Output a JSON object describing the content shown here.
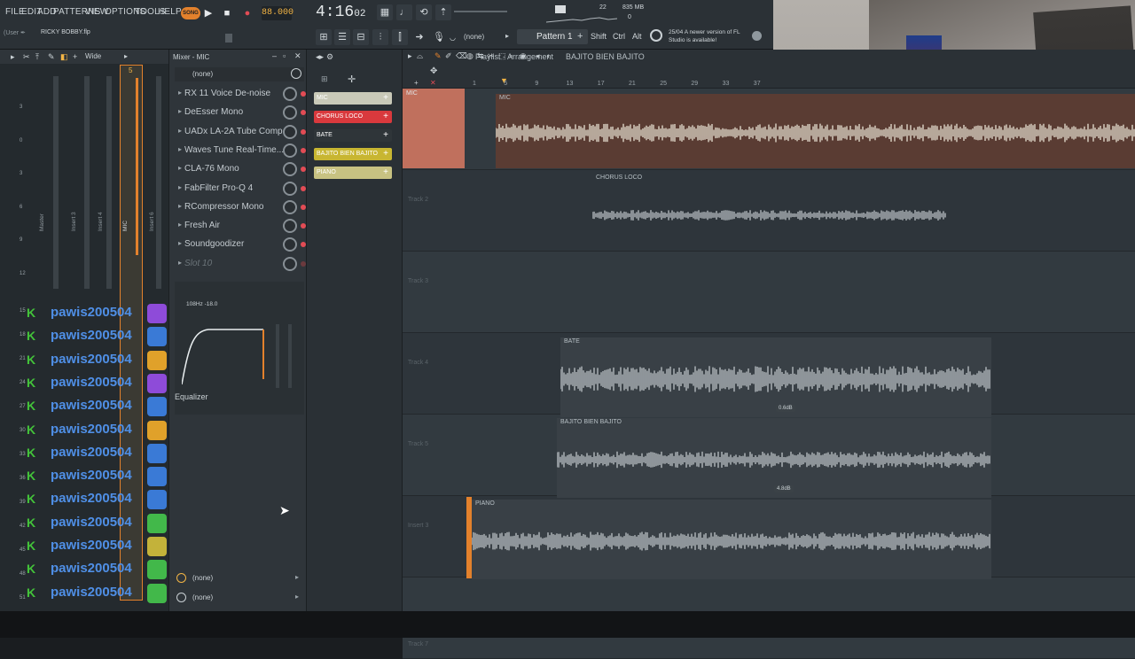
{
  "menu": [
    "FILE",
    "EDIT",
    "ADD",
    "PATTERNS",
    "VIEW",
    "OPTIONS",
    "TOOLS",
    "HELP"
  ],
  "transport": {
    "song_label": "SONG",
    "bpm": "88.000",
    "time": "4:16",
    "time_sub": "02",
    "pattern": "Pattern 1",
    "hint_num": "22",
    "memory": "835 MB",
    "cpu": "0"
  },
  "file": {
    "user": "(User ✒",
    "name": "RICKY BOBBY.flp"
  },
  "modifier_keys": [
    "Shift",
    "Ctrl",
    "Alt"
  ],
  "snap": "(none)",
  "news": "25/04  A newer version of FL Studio is available!",
  "mixer": {
    "title": "Mixer - MIC",
    "wide_label": "Wide",
    "preset": "(none)",
    "slots": [
      {
        "name": "RX 11 Voice De-noise",
        "active": true
      },
      {
        "name": "DeEsser Mono",
        "active": true
      },
      {
        "name": "UADx LA-2A Tube Comp...",
        "active": true
      },
      {
        "name": "Waves Tune Real-Time...",
        "active": true
      },
      {
        "name": "CLA-76 Mono",
        "active": true
      },
      {
        "name": "FabFilter Pro-Q 4",
        "active": true
      },
      {
        "name": "RCompressor Mono",
        "active": true
      },
      {
        "name": "Fresh Air",
        "active": true
      },
      {
        "name": "Soundgoodizer",
        "active": true
      },
      {
        "name": "Slot 10",
        "active": false
      }
    ],
    "eq_readout": "108Hz -18.0",
    "eq_label": "Equalizer",
    "bottom_slots": [
      "(none)",
      "(none)"
    ],
    "strip_labels": [
      "Master",
      "Insert 3",
      "Insert 4",
      "MIC",
      "Insert 6"
    ],
    "scale": [
      "3",
      "0",
      "3",
      "6",
      "9",
      "12",
      "15",
      "18",
      "21",
      "24",
      "27",
      "30",
      "33",
      "36",
      "39",
      "42",
      "45",
      "48",
      "51"
    ],
    "selected_insert": "5"
  },
  "channel_rack": {
    "channels": [
      {
        "name": "MIC",
        "color": "#c9c9b8"
      },
      {
        "name": "CHORUS LOCO",
        "color": "#d9393d"
      },
      {
        "name": "BATE",
        "color": "#2f3539"
      },
      {
        "name": "BAJITO BIEN BAJITO",
        "color": "#c8b632"
      },
      {
        "name": "PIANO",
        "color": "#c8c282"
      }
    ]
  },
  "playlist": {
    "title": "Playlist - Arrangement",
    "breadcrumb": "BAJITO BIEN BAJITO",
    "ruler": [
      "1",
      "5",
      "9",
      "13",
      "17",
      "21",
      "25",
      "29",
      "33",
      "37"
    ],
    "tracks": [
      {
        "label": "MIC",
        "clip": "MIC"
      },
      {
        "label": "Track 2",
        "clip": "CHORUS LOCO"
      },
      {
        "label": "Track 3",
        "clip": ""
      },
      {
        "label": "Track 4",
        "clip": "BATE",
        "db": "0.6dB"
      },
      {
        "label": "Track 5",
        "clip": "BAJITO BIEN BAJITO",
        "db": "4.8dB"
      },
      {
        "label": "Insert 3",
        "clip": "PIANO"
      },
      {
        "label": "Track 7",
        "clip": ""
      }
    ]
  },
  "chat": {
    "username": "pawis200504",
    "rows": 13,
    "emote_colors": [
      "#8e4bd9",
      "#3a7ad6",
      "#e0a12a",
      "#8e4bd9",
      "#3a7ad6",
      "#e0a12a",
      "#3a7ad6",
      "#3a7ad6",
      "#3a7ad6",
      "#42b84a",
      "#c3b23a",
      "#42b84a",
      "#42b84a"
    ]
  },
  "colors": {
    "accent_orange": "#f3b545",
    "chat_name": "#4f8fe6",
    "chat_k": "#43c43a",
    "led_red": "#e24c55"
  }
}
